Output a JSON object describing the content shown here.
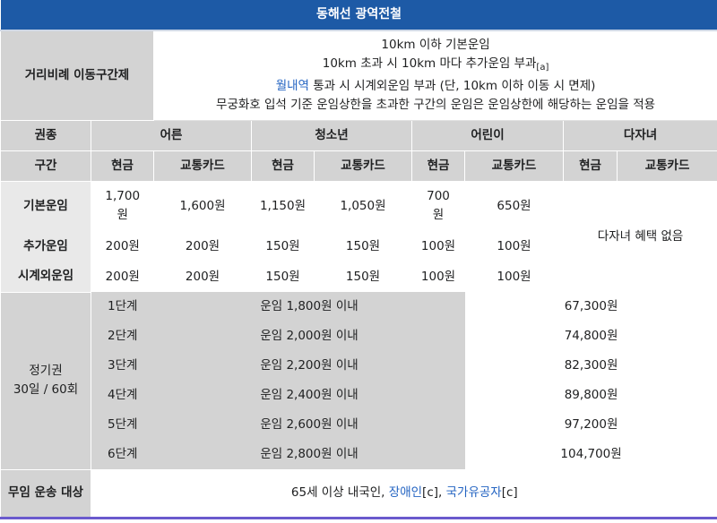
{
  "title": "동해선 광역전철",
  "distance_system": {
    "label": "거리비례 이동구간제",
    "line1": "10km 이하 기본운임",
    "line2": "10km 초과 시 10km 마다 추가운임 부과",
    "line2_ref": "[a]",
    "line3_link": "월내역",
    "line3_rest": " 통과 시 시계외운임 부과 (단, 10km 이하 이동 시 면제)",
    "line4": "무궁화호 입석 기준 운임상한을 초과한 구간의 운임은 운임상한에 해당하는 운임을 적용"
  },
  "ticket_type": {
    "label": "권종",
    "adult": "어른",
    "youth": "청소년",
    "child": "어린이",
    "multi_child": "다자녀"
  },
  "section": {
    "label": "구간",
    "cash": "현금",
    "card": "교통카드"
  },
  "fares": [
    {
      "label": "기본운임",
      "adult_cash": "1,700\n원",
      "adult_card": "1,600원",
      "youth_cash": "1,150원",
      "youth_card": "1,050원",
      "child_cash": "700\n원",
      "child_card": "650원"
    },
    {
      "label": "추가운임",
      "adult_cash": "200원",
      "adult_card": "200원",
      "youth_cash": "150원",
      "youth_card": "150원",
      "child_cash": "100원",
      "child_card": "100원"
    },
    {
      "label": "시계외운임",
      "adult_cash": "200원",
      "adult_card": "200원",
      "youth_cash": "150원",
      "youth_card": "150원",
      "child_cash": "100원",
      "child_card": "100원"
    }
  ],
  "multi_child_note": "다자녀 혜택 없음",
  "commuter_pass": {
    "label_line1": "정기권",
    "label_line2": "30일 / 60회",
    "tiers": [
      {
        "step": "1단계",
        "condition": "운임 1,800원 이내",
        "price": "67,300원"
      },
      {
        "step": "2단계",
        "condition": "운임 2,000원 이내",
        "price": "74,800원"
      },
      {
        "step": "3단계",
        "condition": "운임 2,200원 이내",
        "price": "82,300원"
      },
      {
        "step": "4단계",
        "condition": "운임 2,400원 이내",
        "price": "89,800원"
      },
      {
        "step": "5단계",
        "condition": "운임 2,600원 이내",
        "price": "97,200원"
      },
      {
        "step": "6단계",
        "condition": "운임 2,800원 이내",
        "price": "104,700원"
      }
    ]
  },
  "free_ride": {
    "label": "무임 운송 대상",
    "text_prefix": "65세 이상 내국인, ",
    "link1": "장애인",
    "ref1": "[c]",
    "sep": ", ",
    "link2": "국가유공자",
    "ref2": "[c]"
  }
}
